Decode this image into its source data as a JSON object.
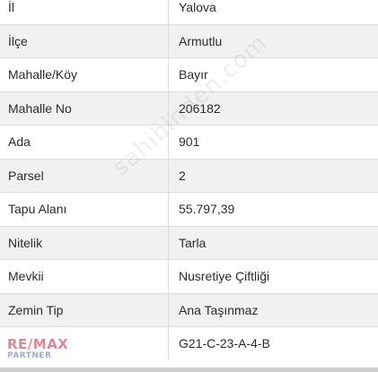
{
  "rows": [
    {
      "label": "İl",
      "value": "Yalova"
    },
    {
      "label": "İlçe",
      "value": "Armutlu"
    },
    {
      "label": "Mahalle/Köy",
      "value": "Bayır"
    },
    {
      "label": "Mahalle No",
      "value": "206182"
    },
    {
      "label": "Ada",
      "value": "901"
    },
    {
      "label": "Parsel",
      "value": "2"
    },
    {
      "label": "Tapu Alanı",
      "value": "55.797,39"
    },
    {
      "label": "Nitelik",
      "value": "Tarla"
    },
    {
      "label": "Mevkii",
      "value": "Nusretiye Çiftliği"
    },
    {
      "label": "Zemin Tip",
      "value": "Ana Taşınmaz"
    },
    {
      "label": "",
      "value": "G21-C-23-A-4-B"
    }
  ],
  "watermark": "sahibinden.com",
  "logo": {
    "main": "RE/MAX",
    "sub": "PARTNER"
  }
}
